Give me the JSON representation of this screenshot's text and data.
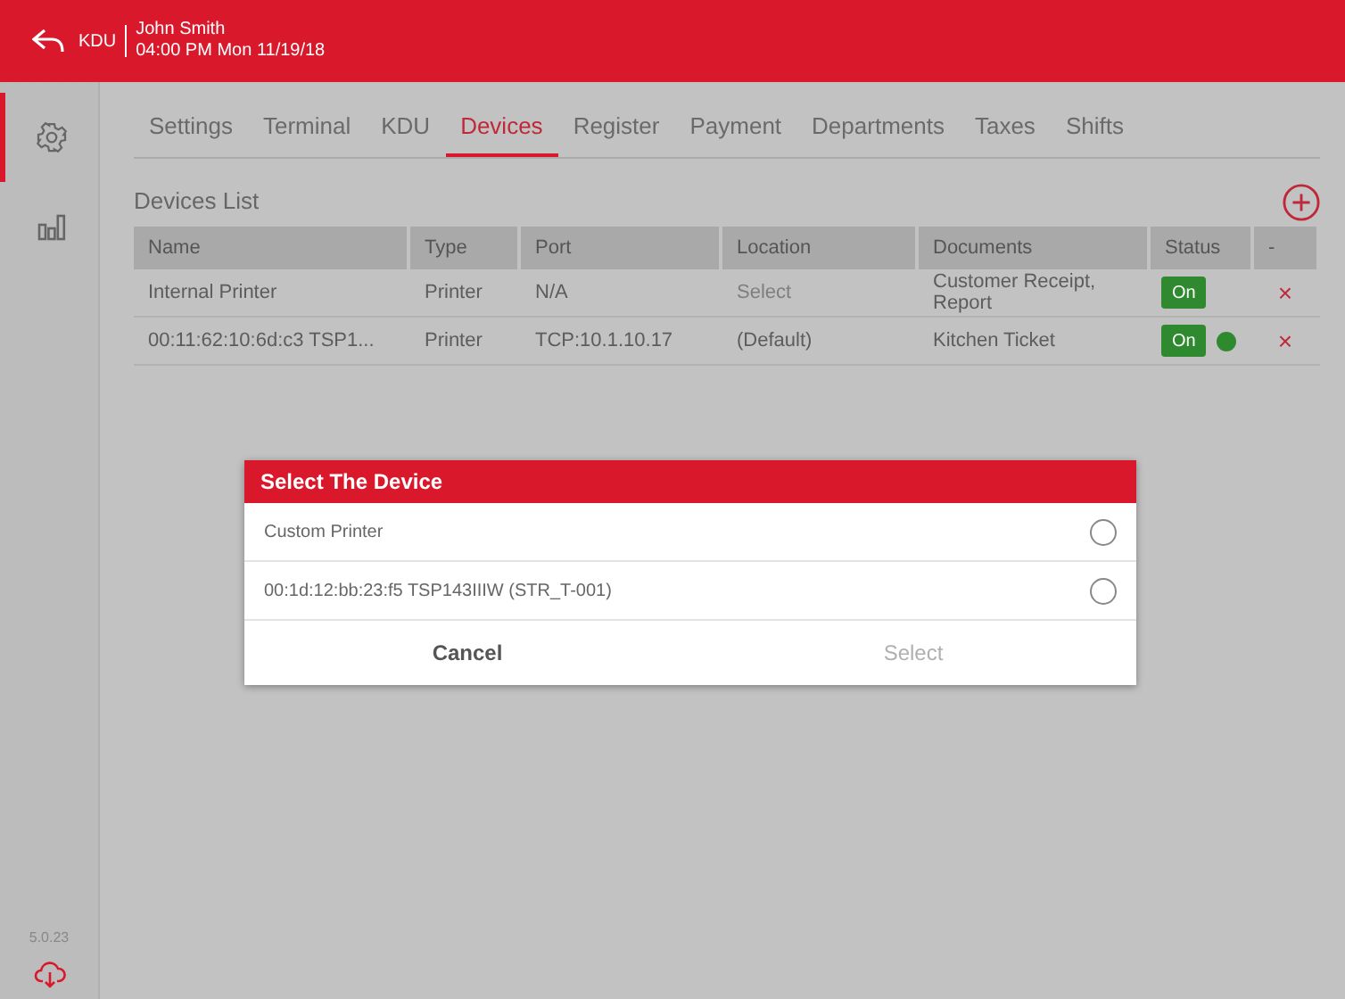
{
  "header": {
    "back_label": "KDU",
    "user": "John Smith",
    "datetime": "04:00 PM Mon 11/19/18"
  },
  "sidebar": {
    "items": [
      {
        "kind": "settings",
        "selected": true
      },
      {
        "kind": "reports",
        "selected": false
      }
    ],
    "version": "5.0.23"
  },
  "tabs": [
    {
      "label": "Settings",
      "selected": false
    },
    {
      "label": "Terminal",
      "selected": false
    },
    {
      "label": "KDU",
      "selected": false
    },
    {
      "label": "Devices",
      "selected": true
    },
    {
      "label": "Register",
      "selected": false
    },
    {
      "label": "Payment",
      "selected": false
    },
    {
      "label": "Departments",
      "selected": false
    },
    {
      "label": "Taxes",
      "selected": false
    },
    {
      "label": "Shifts",
      "selected": false
    }
  ],
  "devices_list": {
    "title": "Devices List",
    "columns": [
      "Name",
      "Type",
      "Port",
      "Location",
      "Documents",
      "Status",
      "-"
    ],
    "rows": [
      {
        "name": "Internal Printer",
        "type": "Printer",
        "port": "N/A",
        "location": "Select",
        "location_placeholder": true,
        "documents": "Customer Receipt, Report",
        "status": "On",
        "connected": false,
        "delete": "×"
      },
      {
        "name": "00:11:62:10:6d:c3 TSP1...",
        "type": "Printer",
        "port": "TCP:10.1.10.17",
        "location": "(Default)",
        "location_placeholder": false,
        "documents": "Kitchen Ticket",
        "status": "On",
        "connected": true,
        "delete": "×"
      }
    ]
  },
  "dialog": {
    "title": "Select The Device",
    "options": [
      {
        "label": "Custom Printer",
        "selected": false
      },
      {
        "label": "00:1d:12:bb:23:f5 TSP143IIIW (STR_T-001)",
        "selected": false
      }
    ],
    "buttons": [
      {
        "label": "Cancel",
        "disabled": false
      },
      {
        "label": "Select",
        "disabled": true
      }
    ]
  }
}
